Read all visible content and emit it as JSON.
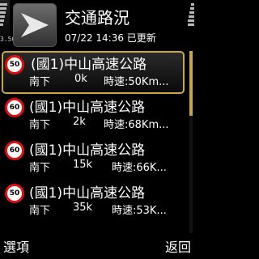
{
  "status": {
    "network_label": "3.5G"
  },
  "header": {
    "title": "交通路況",
    "updated": "07/22 14:36 已更新"
  },
  "items": [
    {
      "speed_limit": "50",
      "road": "(國1)中山高速公路",
      "direction": "南下",
      "distance": "0k",
      "speed": "時速:50Km..."
    },
    {
      "speed_limit": "60",
      "road": "(國1)中山高速公路",
      "direction": "南下",
      "distance": "2k",
      "speed": "時速:68Km..."
    },
    {
      "speed_limit": "60",
      "road": "(國1)中山高速公路",
      "direction": "南下",
      "distance": "15k",
      "speed": "時速:66K..."
    },
    {
      "speed_limit": "50",
      "road": "(國1)中山高速公路",
      "direction": "南下",
      "distance": "35k",
      "speed": "時速:53K..."
    }
  ],
  "softkeys": {
    "left": "選項",
    "right": "返回"
  },
  "colors": {
    "accent": "#c8a64a",
    "sign_border": "#e01010"
  }
}
